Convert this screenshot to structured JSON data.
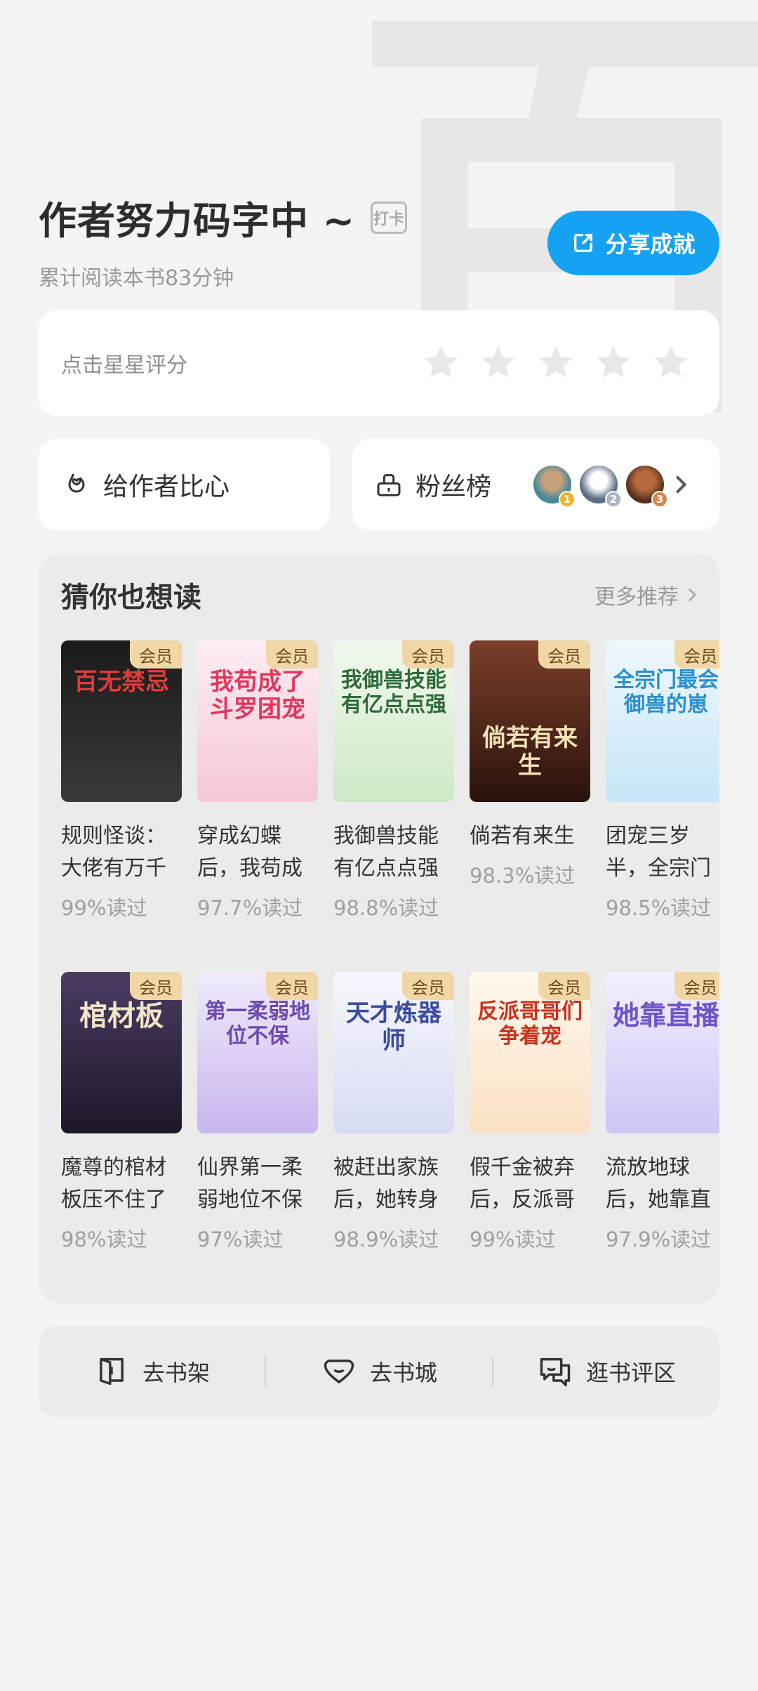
{
  "header": {
    "title": "作者努力码字中 ~",
    "checkin_badge": "打卡",
    "subtitle": "累计阅读本书83分钟",
    "share_label": "分享成就",
    "watermark": "百"
  },
  "rating": {
    "label": "点击星星评分",
    "stars": 5,
    "filled": 0
  },
  "tip": {
    "label": "给作者比心",
    "icon": "heart-hand-icon"
  },
  "fans": {
    "label": "粉丝榜",
    "icon": "trophy-icon",
    "ranks": [
      "1",
      "2",
      "3"
    ],
    "rank_colors": [
      "#f0b429",
      "#a9b4c2",
      "#d9864a"
    ]
  },
  "recommend": {
    "title": "猜你也想读",
    "more_label": "更多推荐",
    "vip_label": "会员",
    "books": [
      {
        "title": "规则怪谈：大佬有万千",
        "pct": "99%读过",
        "cover_text": "百无禁忌",
        "cover_bg": "#2b2b2b",
        "cover_fg": "#e23a3a"
      },
      {
        "title": "穿成幻蝶后，我苟成",
        "pct": "97.7%读过",
        "cover_text": "我苟成了斗罗团宠",
        "cover_bg": "#fbe3ea",
        "cover_fg": "#e0365d"
      },
      {
        "title": "我御兽技能有亿点点强",
        "pct": "98.8%读过",
        "cover_text": "我御兽技能有亿点点强",
        "cover_bg": "#e4f3e1",
        "cover_fg": "#2f6b3a"
      },
      {
        "title": "倘若有来生",
        "pct": "98.3%读过",
        "cover_text": "倘若有来生",
        "cover_bg": "#5a2a1e",
        "cover_fg": "#f5e1b8"
      },
      {
        "title": "团宠三岁半，全宗门",
        "pct": "98.5%读过",
        "cover_text": "全宗门最会御兽的崽",
        "cover_bg": "#dcf0fb",
        "cover_fg": "#2a8fd0"
      },
      {
        "title": "魔尊的棺材板压不住了",
        "pct": "98%读过",
        "cover_text": "棺材板",
        "cover_bg": "#3a2d4a",
        "cover_fg": "#f2e6c9"
      },
      {
        "title": "仙界第一柔弱地位不保",
        "pct": "97%读过",
        "cover_text": "第一柔弱地位不保",
        "cover_bg": "#e6dcf6",
        "cover_fg": "#6c4bb0"
      },
      {
        "title": "被赶出家族后，她转身",
        "pct": "98.9%读过",
        "cover_text": "天才炼器师",
        "cover_bg": "#eef0fa",
        "cover_fg": "#3a4aa0"
      },
      {
        "title": "假千金被弃后，反派哥",
        "pct": "99%读过",
        "cover_text": "反派哥哥们争着宠",
        "cover_bg": "#fff4e6",
        "cover_fg": "#c8321e"
      },
      {
        "title": "流放地球后，她靠直",
        "pct": "97.9%读过",
        "cover_text": "她靠直播",
        "cover_bg": "#e6e0fb",
        "cover_fg": "#6f55c8"
      }
    ]
  },
  "bottom_bar": [
    {
      "label": "去书架",
      "icon": "bookshelf-icon"
    },
    {
      "label": "去书城",
      "icon": "bookstore-icon"
    },
    {
      "label": "逛书评区",
      "icon": "comments-icon"
    }
  ],
  "colors": {
    "accent": "#16a2f2",
    "vip_bg": "#f2d7a6",
    "background": "#f4f4f4"
  }
}
